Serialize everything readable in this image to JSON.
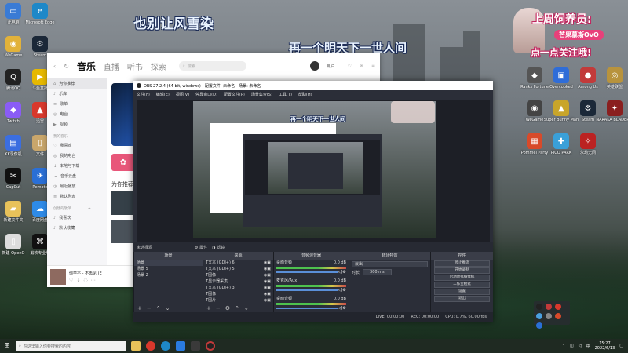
{
  "overlay": {
    "line1": "也别让风雪染",
    "line2": "再一个明天下一世人间"
  },
  "badge": {
    "line1": "上周饲养员:",
    "name": "芒果慕斯OvO",
    "line2": "点一点关注哦!"
  },
  "desktop_icons_left": [
    {
      "label": "此电脑",
      "color": "#3a7bd5",
      "glyph": "▭"
    },
    {
      "label": "Microsoft Edge",
      "color": "#1e88c8",
      "glyph": "e"
    },
    {
      "label": "WeGame",
      "color": "#e2b23a",
      "glyph": "◉"
    },
    {
      "label": "Steam",
      "color": "#1b2838",
      "glyph": "⚙"
    },
    {
      "label": "腾讯QQ",
      "color": "#222",
      "glyph": "Q"
    },
    {
      "label": "斗鱼直播",
      "color": "#e6b800",
      "glyph": "▶"
    },
    {
      "label": "Twitch",
      "color": "#8a5cf6",
      "glyph": "◆"
    },
    {
      "label": "迅雷",
      "color": "#d8382c",
      "glyph": "▲"
    },
    {
      "label": "KK录像机",
      "color": "#3b6ee0",
      "glyph": "▤"
    },
    {
      "label": "文件",
      "color": "#c9a66b",
      "glyph": "▯"
    },
    {
      "label": "CapCut",
      "color": "#111",
      "glyph": "✂"
    },
    {
      "label": "Remote",
      "color": "#2a6fd6",
      "glyph": "✈"
    },
    {
      "label": "新建文件夹",
      "color": "#e8c25a",
      "glyph": "▰"
    },
    {
      "label": "百度网盘",
      "color": "#2e8be8",
      "glyph": "☁"
    },
    {
      "label": "新建 OpenO",
      "color": "#ddd",
      "glyph": "▯"
    },
    {
      "label": "剪映专业版",
      "color": "#111",
      "glyph": "⌘"
    }
  ],
  "desktop_icons_right": [
    {
      "label": "Ranks Fortune",
      "color": "#555",
      "glyph": "◆"
    },
    {
      "label": "Overcooked",
      "color": "#2f6dd8",
      "glyph": "▣"
    },
    {
      "label": "Among Us",
      "color": "#c23a3a",
      "glyph": "●"
    },
    {
      "label": "英雄联盟",
      "color": "#b8933d",
      "glyph": "◎"
    },
    {
      "label": "WeGame",
      "color": "#444",
      "glyph": "◉"
    },
    {
      "label": "Super Bunny Man",
      "color": "#c8a52a",
      "glyph": "▲"
    },
    {
      "label": "Steam",
      "color": "#1b2838",
      "glyph": "⚙"
    },
    {
      "label": "NARAKA BLADEPOI",
      "color": "#8a1f1f",
      "glyph": "✦"
    },
    {
      "label": "Pommel Party",
      "color": "#d84a2a",
      "glyph": "▦"
    },
    {
      "label": "PICO PARK",
      "color": "#3aa0d8",
      "glyph": "✚"
    },
    {
      "label": "永劫无间",
      "color": "#b22",
      "glyph": "✧"
    }
  ],
  "music": {
    "tabs": [
      "音乐",
      "直播",
      "听书",
      "探索"
    ],
    "search_placeholder": "搜索",
    "sidebar": [
      {
        "label": "为你推荐",
        "icon": "home-icon",
        "glyph": "⌂"
      },
      {
        "label": "乐库",
        "icon": "library-icon",
        "glyph": "♪"
      },
      {
        "label": "歌单",
        "icon": "playlist-icon",
        "glyph": "≡"
      },
      {
        "label": "电台",
        "icon": "radio-icon",
        "glyph": "◎"
      },
      {
        "label": "视频",
        "icon": "video-icon",
        "glyph": "▶"
      }
    ],
    "my_music_header": "我的音乐",
    "my_music": [
      {
        "label": "我喜欢",
        "icon": "heart-icon",
        "glyph": "♡"
      },
      {
        "label": "我的电台",
        "icon": "radio-icon",
        "glyph": "◎"
      },
      {
        "label": "本地与下载",
        "icon": "download-icon",
        "glyph": "↓"
      },
      {
        "label": "音乐云盘",
        "icon": "cloud-icon",
        "glyph": "☁"
      },
      {
        "label": "最近播放",
        "icon": "clock-icon",
        "glyph": "◷"
      },
      {
        "label": "默认列表",
        "icon": "list-icon",
        "glyph": "≡"
      }
    ],
    "created_header": "创建的歌单",
    "created": [
      {
        "label": "我喜欢"
      },
      {
        "label": "默认收藏"
      }
    ],
    "section_title": "为你推荐",
    "now_playing": "你学不 - 不再见 (E",
    "user_name": "用户"
  },
  "obs": {
    "title": "OBS 27.2.4 (64-bit, windows) - 配置文件: 未命名 - 场景: 未命名",
    "menu": [
      "文件(F)",
      "编辑(E)",
      "视图(V)",
      "停靠窗口(D)",
      "配置文件(P)",
      "场景集合(S)",
      "工具(T)",
      "帮助(H)"
    ],
    "source_toolbar": {
      "label": "未选择源",
      "properties": "属性",
      "filters": "滤镜"
    },
    "docks": {
      "scenes": "场景",
      "sources": "来源",
      "mixer": "音频混音器",
      "transitions": "转场特效",
      "controls": "控件"
    },
    "scenes": [
      "场景",
      "场景 5",
      "场景 2"
    ],
    "sources": [
      "文本 (GDI+) 6",
      "文本 (GDI+) 5",
      "图像",
      "显示器采集",
      "文本 (GDI+) 3",
      "图像",
      "图片"
    ],
    "mixer": [
      {
        "name": "桌面音频",
        "level": "0.0 dB"
      },
      {
        "name": "麦克风/Aux",
        "level": "0.0 dB"
      },
      {
        "name": "桌面音频",
        "level": "0.0 dB"
      }
    ],
    "transition": {
      "type": "淡出",
      "duration_label": "时长",
      "duration": "300 ms"
    },
    "controls": [
      "停止推流",
      "开始录制",
      "启动虚拟摄像机",
      "工作室模式",
      "设置",
      "退出"
    ],
    "status": {
      "live": "LIVE: 00:00:00",
      "rec": "REC: 00:00:00",
      "cpu": "CPU: 0.7%, 60.00 fps"
    }
  },
  "taskbar": {
    "search_placeholder": "在这里输入你要搜索的内容",
    "time": "15:27",
    "date": "2022/6/13",
    "lang": "中"
  }
}
